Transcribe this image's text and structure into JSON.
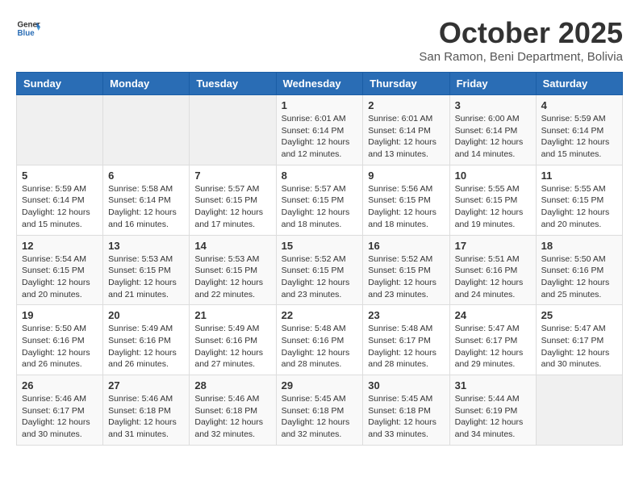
{
  "logo": {
    "text_general": "General",
    "text_blue": "Blue"
  },
  "header": {
    "month": "October 2025",
    "location": "San Ramon, Beni Department, Bolivia"
  },
  "weekdays": [
    "Sunday",
    "Monday",
    "Tuesday",
    "Wednesday",
    "Thursday",
    "Friday",
    "Saturday"
  ],
  "weeks": [
    [
      {
        "day": "",
        "info": ""
      },
      {
        "day": "",
        "info": ""
      },
      {
        "day": "",
        "info": ""
      },
      {
        "day": "1",
        "info": "Sunrise: 6:01 AM\nSunset: 6:14 PM\nDaylight: 12 hours\nand 12 minutes."
      },
      {
        "day": "2",
        "info": "Sunrise: 6:01 AM\nSunset: 6:14 PM\nDaylight: 12 hours\nand 13 minutes."
      },
      {
        "day": "3",
        "info": "Sunrise: 6:00 AM\nSunset: 6:14 PM\nDaylight: 12 hours\nand 14 minutes."
      },
      {
        "day": "4",
        "info": "Sunrise: 5:59 AM\nSunset: 6:14 PM\nDaylight: 12 hours\nand 15 minutes."
      }
    ],
    [
      {
        "day": "5",
        "info": "Sunrise: 5:59 AM\nSunset: 6:14 PM\nDaylight: 12 hours\nand 15 minutes."
      },
      {
        "day": "6",
        "info": "Sunrise: 5:58 AM\nSunset: 6:14 PM\nDaylight: 12 hours\nand 16 minutes."
      },
      {
        "day": "7",
        "info": "Sunrise: 5:57 AM\nSunset: 6:15 PM\nDaylight: 12 hours\nand 17 minutes."
      },
      {
        "day": "8",
        "info": "Sunrise: 5:57 AM\nSunset: 6:15 PM\nDaylight: 12 hours\nand 18 minutes."
      },
      {
        "day": "9",
        "info": "Sunrise: 5:56 AM\nSunset: 6:15 PM\nDaylight: 12 hours\nand 18 minutes."
      },
      {
        "day": "10",
        "info": "Sunrise: 5:55 AM\nSunset: 6:15 PM\nDaylight: 12 hours\nand 19 minutes."
      },
      {
        "day": "11",
        "info": "Sunrise: 5:55 AM\nSunset: 6:15 PM\nDaylight: 12 hours\nand 20 minutes."
      }
    ],
    [
      {
        "day": "12",
        "info": "Sunrise: 5:54 AM\nSunset: 6:15 PM\nDaylight: 12 hours\nand 20 minutes."
      },
      {
        "day": "13",
        "info": "Sunrise: 5:53 AM\nSunset: 6:15 PM\nDaylight: 12 hours\nand 21 minutes."
      },
      {
        "day": "14",
        "info": "Sunrise: 5:53 AM\nSunset: 6:15 PM\nDaylight: 12 hours\nand 22 minutes."
      },
      {
        "day": "15",
        "info": "Sunrise: 5:52 AM\nSunset: 6:15 PM\nDaylight: 12 hours\nand 23 minutes."
      },
      {
        "day": "16",
        "info": "Sunrise: 5:52 AM\nSunset: 6:15 PM\nDaylight: 12 hours\nand 23 minutes."
      },
      {
        "day": "17",
        "info": "Sunrise: 5:51 AM\nSunset: 6:16 PM\nDaylight: 12 hours\nand 24 minutes."
      },
      {
        "day": "18",
        "info": "Sunrise: 5:50 AM\nSunset: 6:16 PM\nDaylight: 12 hours\nand 25 minutes."
      }
    ],
    [
      {
        "day": "19",
        "info": "Sunrise: 5:50 AM\nSunset: 6:16 PM\nDaylight: 12 hours\nand 26 minutes."
      },
      {
        "day": "20",
        "info": "Sunrise: 5:49 AM\nSunset: 6:16 PM\nDaylight: 12 hours\nand 26 minutes."
      },
      {
        "day": "21",
        "info": "Sunrise: 5:49 AM\nSunset: 6:16 PM\nDaylight: 12 hours\nand 27 minutes."
      },
      {
        "day": "22",
        "info": "Sunrise: 5:48 AM\nSunset: 6:16 PM\nDaylight: 12 hours\nand 28 minutes."
      },
      {
        "day": "23",
        "info": "Sunrise: 5:48 AM\nSunset: 6:17 PM\nDaylight: 12 hours\nand 28 minutes."
      },
      {
        "day": "24",
        "info": "Sunrise: 5:47 AM\nSunset: 6:17 PM\nDaylight: 12 hours\nand 29 minutes."
      },
      {
        "day": "25",
        "info": "Sunrise: 5:47 AM\nSunset: 6:17 PM\nDaylight: 12 hours\nand 30 minutes."
      }
    ],
    [
      {
        "day": "26",
        "info": "Sunrise: 5:46 AM\nSunset: 6:17 PM\nDaylight: 12 hours\nand 30 minutes."
      },
      {
        "day": "27",
        "info": "Sunrise: 5:46 AM\nSunset: 6:18 PM\nDaylight: 12 hours\nand 31 minutes."
      },
      {
        "day": "28",
        "info": "Sunrise: 5:46 AM\nSunset: 6:18 PM\nDaylight: 12 hours\nand 32 minutes."
      },
      {
        "day": "29",
        "info": "Sunrise: 5:45 AM\nSunset: 6:18 PM\nDaylight: 12 hours\nand 32 minutes."
      },
      {
        "day": "30",
        "info": "Sunrise: 5:45 AM\nSunset: 6:18 PM\nDaylight: 12 hours\nand 33 minutes."
      },
      {
        "day": "31",
        "info": "Sunrise: 5:44 AM\nSunset: 6:19 PM\nDaylight: 12 hours\nand 34 minutes."
      },
      {
        "day": "",
        "info": ""
      }
    ]
  ]
}
